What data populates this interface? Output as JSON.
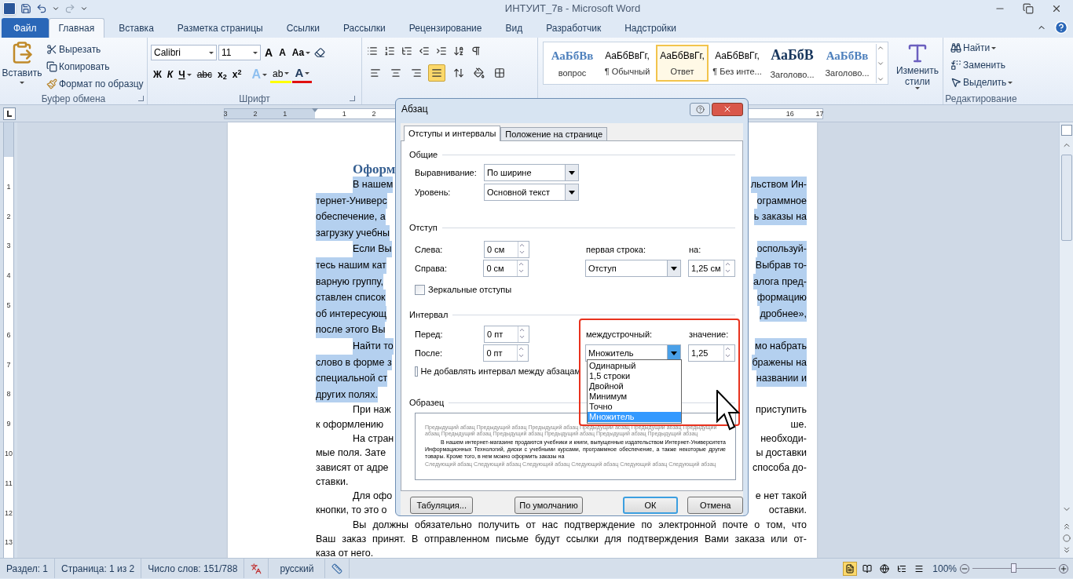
{
  "window": {
    "title": "ИНТУИТ_7в - Microsoft Word"
  },
  "ribbon_tabs": [
    {
      "label": "Файл",
      "kind": "file",
      "selected": false
    },
    {
      "label": "Главная",
      "kind": "tab",
      "selected": true
    },
    {
      "label": "Вставка",
      "kind": "tab",
      "selected": false
    },
    {
      "label": "Разметка страницы",
      "kind": "tab",
      "selected": false
    },
    {
      "label": "Ссылки",
      "kind": "tab",
      "selected": false
    },
    {
      "label": "Рассылки",
      "kind": "tab",
      "selected": false
    },
    {
      "label": "Рецензирование",
      "kind": "tab",
      "selected": false
    },
    {
      "label": "Вид",
      "kind": "tab",
      "selected": false
    },
    {
      "label": "Разработчик",
      "kind": "tab",
      "selected": false
    },
    {
      "label": "Надстройки",
      "kind": "tab",
      "selected": false
    }
  ],
  "clipboard": {
    "paste": "Вставить",
    "cut": "Вырезать",
    "copy": "Копировать",
    "format_painter": "Формат по образцу",
    "label": "Буфер обмена"
  },
  "font": {
    "name": "Calibri",
    "size": "11",
    "grow": "A",
    "shrink": "A",
    "change_case": "Aa",
    "bold": "Ж",
    "italic": "К",
    "underline": "Ч",
    "strikethrough": "abc",
    "subscript": "x$_{2}$",
    "superscript": "x$^{2}$",
    "text_effects": "A",
    "highlight": "ab",
    "font_color": "A",
    "label": "Шрифт"
  },
  "paragraph": {
    "alignment_buttons": [
      {
        "kind": "left",
        "selected": false
      },
      {
        "kind": "center",
        "selected": false
      },
      {
        "kind": "right",
        "selected": false
      },
      {
        "kind": "justify",
        "selected": true
      }
    ]
  },
  "styles": [
    {
      "sample": "АаБбВв",
      "name": "вопрос",
      "kind": "heading",
      "selected": false
    },
    {
      "sample": "АаБбВвГг,",
      "name": "¶ Обычный",
      "kind": "normal",
      "selected": false
    },
    {
      "sample": "АаБбВвГг,",
      "name": "Ответ",
      "kind": "normal",
      "selected": true
    },
    {
      "sample": "АаБбВвГг,",
      "name": "¶ Без инте...",
      "kind": "normal",
      "selected": false
    },
    {
      "sample": "АаБбВ",
      "name": "Заголово...",
      "kind": "title",
      "selected": false
    },
    {
      "sample": "АаБбВв",
      "name": "Заголово...",
      "kind": "heading",
      "selected": false
    }
  ],
  "change_styles": "Изменить стили",
  "editing": {
    "find": "Найти",
    "replace": "Заменить",
    "select": "Выделить",
    "label": "Редактирование"
  },
  "ruler": {
    "left_numbers": [
      "3",
      "2",
      "1",
      "1",
      "2"
    ],
    "right_numbers": [
      "16",
      "17"
    ],
    "side_numbers": [
      "1",
      "2",
      "3",
      "4",
      "5",
      "6",
      "7",
      "8",
      "9",
      "10",
      "11",
      "12",
      "13"
    ]
  },
  "document": {
    "heading": "Оформ",
    "paragraphs": [
      {
        "selected": true,
        "lines": [
          {
            "left": "В нашем",
            "right": "льством Ин-"
          },
          {
            "left": "тернет-Универс",
            "right": "ограммное"
          },
          {
            "left": "обеспечение, а",
            "right": "ь заказы на"
          },
          {
            "left": "загрузку учебны"
          }
        ]
      },
      {
        "selected": true,
        "lines": [
          {
            "left": "Если Вы",
            "right": "оспользуй-"
          },
          {
            "left": "тесь нашим кат",
            "right": "Выбрав то-"
          },
          {
            "left": "варную группу,",
            "right": "алога пред-"
          },
          {
            "left": "ставлен список",
            "right": "формацию"
          },
          {
            "left": "об интересующ",
            "right": "дробнее»,"
          },
          {
            "left": "после этого Вы"
          }
        ]
      },
      {
        "selected": true,
        "lines": [
          {
            "left": "Найти то",
            "right": "мо набрать"
          },
          {
            "left": "слово в форме з",
            "right": "бражены на"
          },
          {
            "left": "специальной ст",
            "right": "названии и"
          },
          {
            "left": "других полях."
          }
        ]
      },
      {
        "selected": false,
        "lines": [
          {
            "left": "При наж",
            "right": "приступить"
          },
          {
            "left": "к оформлению",
            "right": "ше."
          }
        ]
      },
      {
        "selected": false,
        "lines": [
          {
            "left": "На стран",
            "right": "необходи-"
          },
          {
            "left": "мые поля. Зате",
            "right": "ы доставки"
          },
          {
            "left": "зависят от адре",
            "right": "способа до-"
          },
          {
            "left": "ставки."
          }
        ]
      },
      {
        "selected": false,
        "lines": [
          {
            "left": "Для офо",
            "right": "е нет такой"
          },
          {
            "left": "кнопки, то это о",
            "right": "оставки."
          }
        ]
      },
      {
        "selected": false,
        "lines": [
          {
            "text": "Вы должны обязательно получить от нас подтверждение по электронной почте о том, что"
          },
          {
            "text": "Ваш заказ принят. В отправленном письме будут ссылки для подтверждения Вами заказа или от-"
          },
          {
            "text": "каза от него."
          }
        ]
      }
    ]
  },
  "dialog": {
    "title": "Абзац",
    "tabs": [
      {
        "label": "Отступы и интервалы",
        "selected": true
      },
      {
        "label": "Положение на странице",
        "selected": false
      }
    ],
    "general": {
      "heading": "Общие",
      "alignment_label": "Выравнивание:",
      "alignment": "По ширине",
      "level_label": "Уровень:",
      "level_value": "Основной текст"
    },
    "indent": {
      "heading": "Отступ",
      "left_label": "Слева:",
      "left": "0 см",
      "right_label": "Справа:",
      "right": "0 см",
      "first_line_label": "первая строка:",
      "first_line": "Отступ",
      "by_label": "на:",
      "by": "1,25 см",
      "mirror": {
        "label": "Зеркальные отступы",
        "checked": false
      }
    },
    "spacing": {
      "heading": "Интервал",
      "before_label": "Перед:",
      "before": "0 пт",
      "after_label": "После:",
      "after": "0 пт",
      "line_label": "междустрочный:",
      "line": "Множитель",
      "at_label": "значение:",
      "at": "1,25",
      "no_space": {
        "label": "Не добавлять интервал между абзацам",
        "checked": false
      },
      "dropdown_open": true,
      "line_options": [
        {
          "label": "Одинарный",
          "selected": false
        },
        {
          "label": "1,5 строки",
          "selected": false
        },
        {
          "label": "Двойной",
          "selected": false
        },
        {
          "label": "Минимум",
          "selected": false
        },
        {
          "label": "Точно",
          "selected": false
        },
        {
          "label": "Множитель",
          "selected": true
        }
      ]
    },
    "preview": {
      "heading": "Образец",
      "previous": "Предыдущий абзац Предыдущий абзац Предыдущий абзац Предыдущий абзац Предыдущий абзац Предыдущий абзац Предыдущий абзац Предыдущий абзац Предыдущий абзац Предыдущий абзац Предыдущий абзац",
      "sample": "В нашем интернет-магазине продаются учебники и книги, выпущенные издательством Интернет-Университета Информационных Технологий, диски с учебными курсами, программное обеспечение, а также некоторые другие товары. Кроме того, в нем можно оформить заказы на",
      "next": "Следующий абзац Следующий абзац Следующий абзац Следующий абзац Следующий абзац Следующий абзац"
    },
    "buttons": [
      {
        "label": "Табуляция...",
        "default": false
      },
      {
        "label": "По умолчанию",
        "default": false
      },
      {
        "label": "ОК",
        "default": true
      },
      {
        "label": "Отмена",
        "default": false
      }
    ]
  },
  "status_bar": {
    "section": "Раздел: 1",
    "page": "Страница: 1 из 2",
    "words": "Число слов: 151/788",
    "language": "русский",
    "views": [
      {
        "kind": "print",
        "selected": true
      },
      {
        "kind": "reading",
        "selected": false
      },
      {
        "kind": "web",
        "selected": false
      },
      {
        "kind": "outline",
        "selected": false
      },
      {
        "kind": "draft",
        "selected": false
      }
    ],
    "zoom": "100%",
    "zoom_slider": {
      "level": 0.5
    }
  }
}
